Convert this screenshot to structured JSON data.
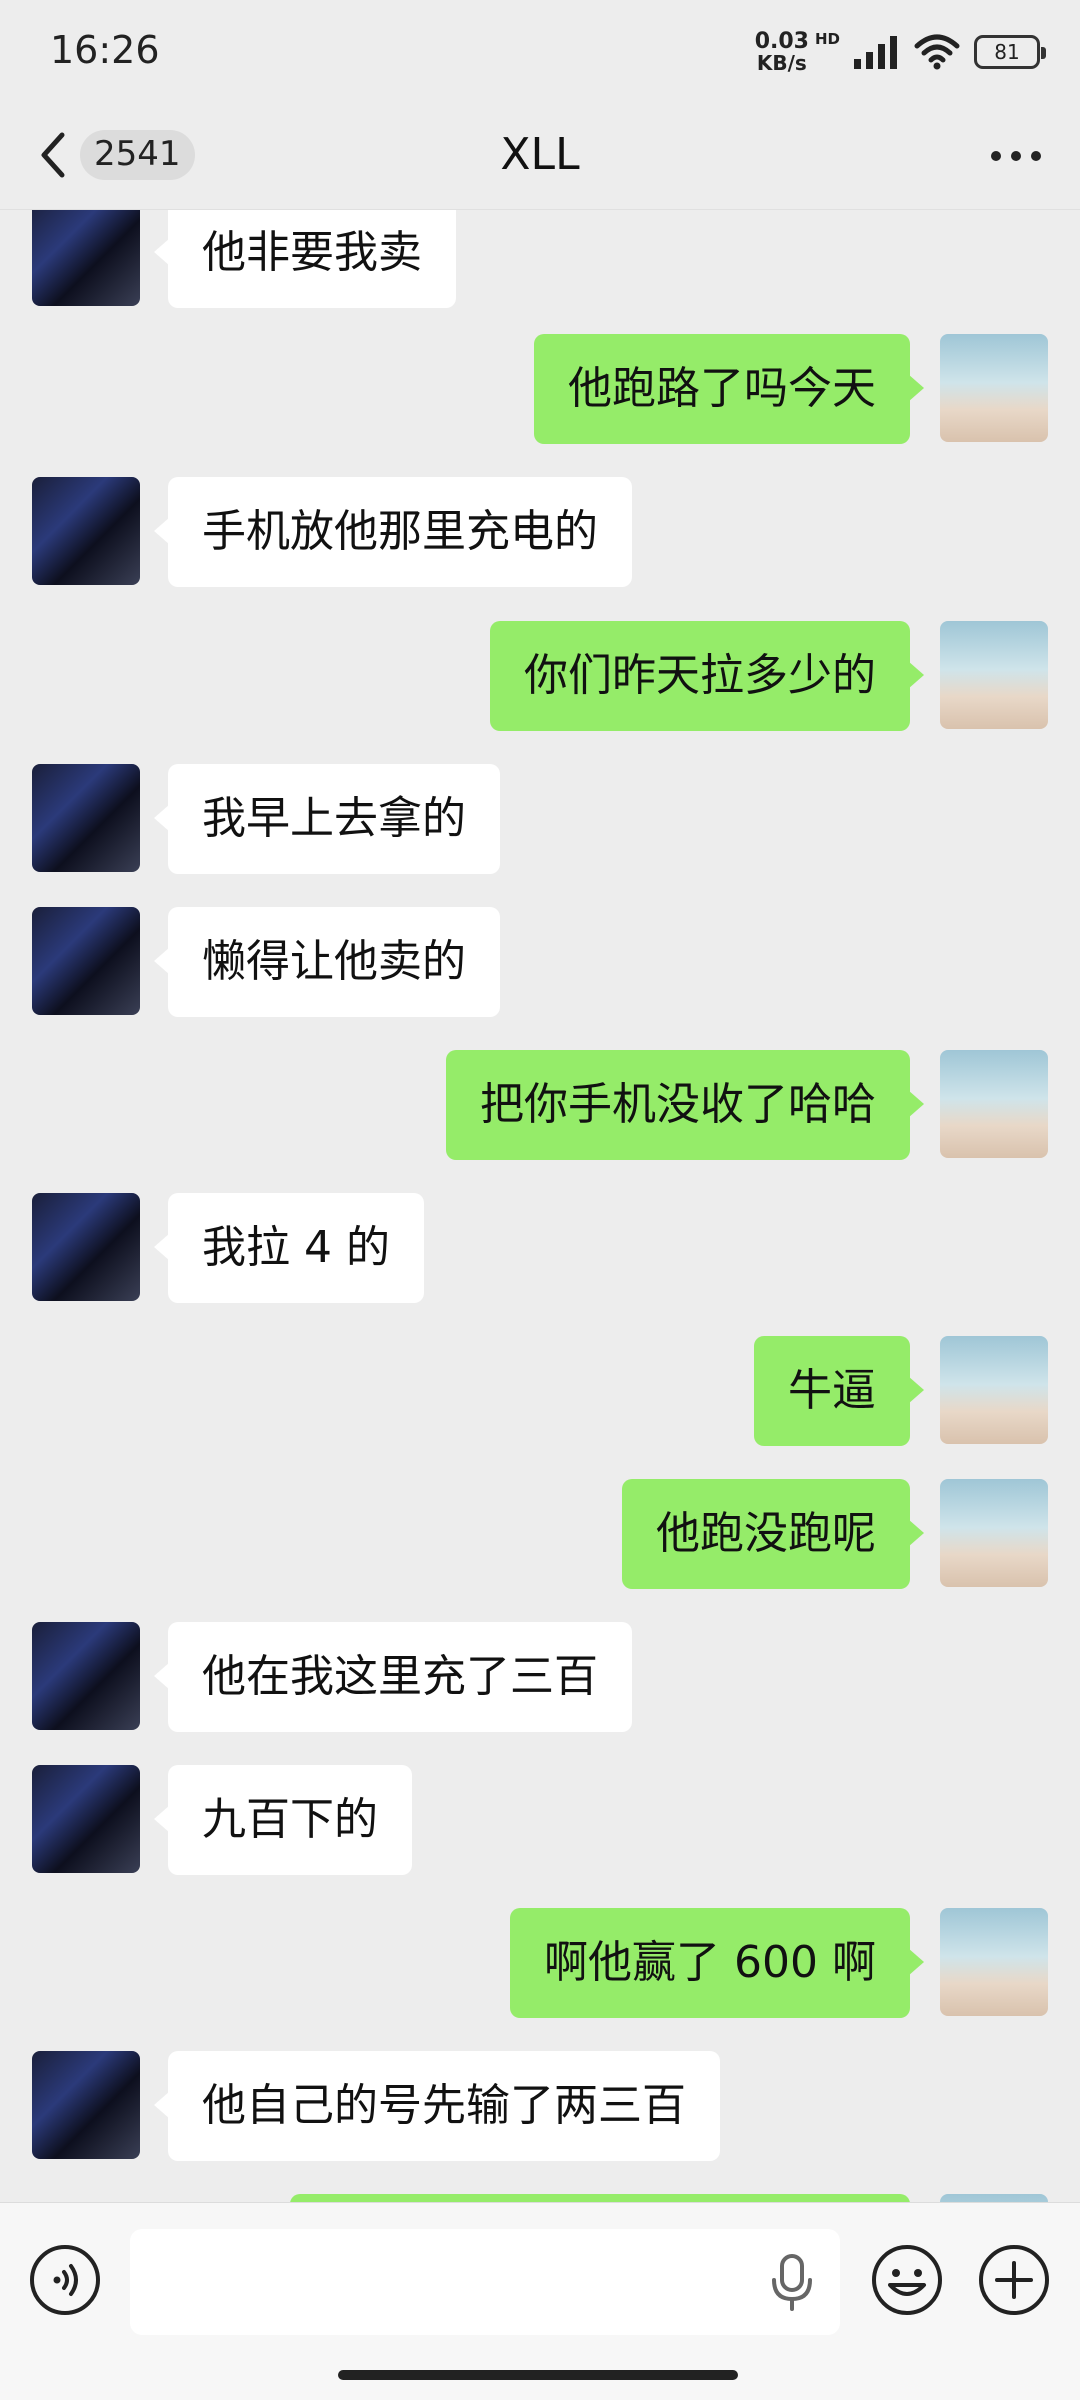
{
  "status_bar": {
    "time": "16:26",
    "net_speed_value": "0.03",
    "net_speed_unit": "KB/s",
    "network_type": "HD",
    "battery": "81"
  },
  "header": {
    "unread_count": "2541",
    "title": "XLL"
  },
  "messages": [
    {
      "side": "left",
      "text": "他非要我卖"
    },
    {
      "side": "right",
      "text": "他跑路了吗今天"
    },
    {
      "side": "left",
      "text": "手机放他那里充电的"
    },
    {
      "side": "right",
      "text": "你们昨天拉多少的"
    },
    {
      "side": "left",
      "text": "我早上去拿的"
    },
    {
      "side": "left",
      "text": "懒得让他卖的"
    },
    {
      "side": "right",
      "text": "把你手机没收了哈哈"
    },
    {
      "side": "left",
      "text": "我拉 4 的"
    },
    {
      "side": "right",
      "text": "牛逼"
    },
    {
      "side": "right",
      "text": "他跑没跑呢"
    },
    {
      "side": "left",
      "text": "他在我这里充了三百"
    },
    {
      "side": "left",
      "text": "九百下的"
    },
    {
      "side": "right",
      "text": "啊他赢了 600 啊"
    },
    {
      "side": "left",
      "text": "他自己的号先输了两三百"
    },
    {
      "side": "right",
      "text": ""
    }
  ],
  "colors": {
    "background": "#ededed",
    "sent_bubble": "#95ec69",
    "received_bubble": "#ffffff",
    "input_bar": "#f7f7f7"
  },
  "icons": {
    "back": "chevron-left-icon",
    "more": "more-dots-icon",
    "voice": "voice-icon",
    "mic": "mic-icon",
    "emoji": "emoji-icon",
    "plus": "plus-icon"
  }
}
